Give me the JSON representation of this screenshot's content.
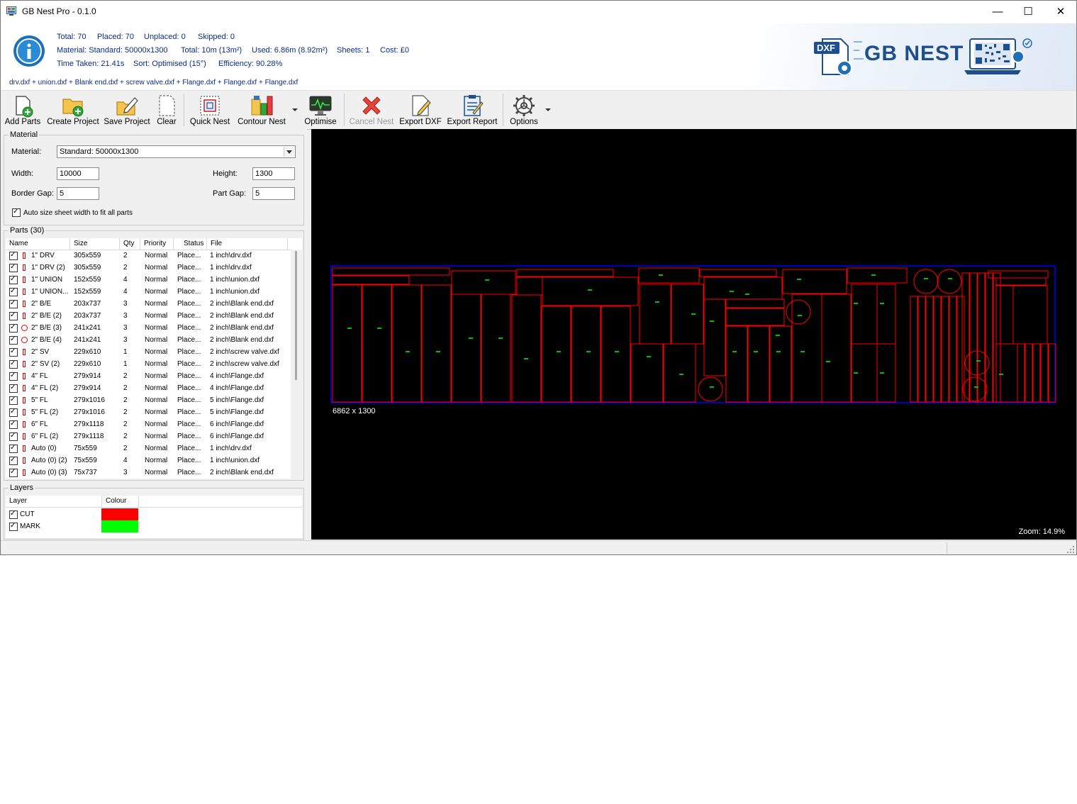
{
  "window": {
    "title": "GB Nest Pro - 0.1.0",
    "controls": {
      "minimize": "—",
      "maximize": "☐",
      "close": "✕"
    }
  },
  "stats": {
    "total": "Total: 70",
    "placed": "Placed: 70",
    "unplaced": "Unplaced: 0",
    "skipped": "Skipped: 0",
    "material": "Material: Standard: 50000x1300",
    "total_len": "Total: 10m (13m²)",
    "used": "Used: 6.86m (8.92m²)",
    "sheets": "Sheets: 1",
    "cost": "Cost: £0",
    "time": "Time Taken: 21.41s",
    "sort": "Sort: Optimised (15°)",
    "efficiency": "Efficiency: 90.28%",
    "files": "drv.dxf + union.dxf + Blank end.dxf + screw valve.dxf + Flange.dxf + Flange.dxf + Flange.dxf"
  },
  "logo": {
    "badge": "DXF",
    "name": "GB NEST"
  },
  "toolbar": {
    "add_parts": "Add Parts",
    "create_project": "Create Project",
    "save_project": "Save Project",
    "clear": "Clear",
    "quick_nest": "Quick Nest",
    "contour_nest": "Contour Nest",
    "optimise": "Optimise",
    "cancel_nest": "Cancel Nest",
    "export_dxf": "Export DXF",
    "export_report": "Export Report",
    "options": "Options"
  },
  "material": {
    "group_title": "Material",
    "material_label": "Material:",
    "material_value": "Standard: 50000x1300",
    "width_label": "Width:",
    "width_value": "10000",
    "height_label": "Height:",
    "height_value": "1300",
    "border_gap_label": "Border Gap:",
    "border_gap_value": "5",
    "part_gap_label": "Part Gap:",
    "part_gap_value": "5",
    "auto_size_label": "Auto size sheet width to fit all parts"
  },
  "parts": {
    "group_title": "Parts (30)",
    "columns": [
      "Name",
      "Size",
      "Qty",
      "Priority",
      "Status",
      "File"
    ],
    "rows": [
      {
        "shape": "rect",
        "name": "1\" DRV",
        "size": "305x559",
        "qty": "2",
        "priority": "Normal",
        "status": "Place...",
        "file": "1 inch\\drv.dxf"
      },
      {
        "shape": "rect",
        "name": "1\" DRV (2)",
        "size": "305x559",
        "qty": "2",
        "priority": "Normal",
        "status": "Place...",
        "file": "1 inch\\drv.dxf"
      },
      {
        "shape": "rect",
        "name": "1\" UNION",
        "size": "152x559",
        "qty": "4",
        "priority": "Normal",
        "status": "Place...",
        "file": "1 inch\\union.dxf"
      },
      {
        "shape": "rect",
        "name": "1\" UNION...",
        "size": "152x559",
        "qty": "4",
        "priority": "Normal",
        "status": "Place...",
        "file": "1 inch\\union.dxf"
      },
      {
        "shape": "rect",
        "name": "2\" B/E",
        "size": "203x737",
        "qty": "3",
        "priority": "Normal",
        "status": "Place...",
        "file": "2 inch\\Blank end.dxf"
      },
      {
        "shape": "rect",
        "name": "2\" B/E (2)",
        "size": "203x737",
        "qty": "3",
        "priority": "Normal",
        "status": "Place...",
        "file": "2 inch\\Blank end.dxf"
      },
      {
        "shape": "circle",
        "name": "2\" B/E (3)",
        "size": "241x241",
        "qty": "3",
        "priority": "Normal",
        "status": "Place...",
        "file": "2 inch\\Blank end.dxf"
      },
      {
        "shape": "circle",
        "name": "2\" B/E (4)",
        "size": "241x241",
        "qty": "3",
        "priority": "Normal",
        "status": "Place...",
        "file": "2 inch\\Blank end.dxf"
      },
      {
        "shape": "rect",
        "name": "2\" SV",
        "size": "229x610",
        "qty": "1",
        "priority": "Normal",
        "status": "Place...",
        "file": "2 inch\\screw valve.dxf"
      },
      {
        "shape": "rect",
        "name": "2\" SV (2)",
        "size": "229x610",
        "qty": "1",
        "priority": "Normal",
        "status": "Place...",
        "file": "2 inch\\screw valve.dxf"
      },
      {
        "shape": "rect",
        "name": "4\" FL",
        "size": "279x914",
        "qty": "2",
        "priority": "Normal",
        "status": "Place...",
        "file": "4 inch\\Flange.dxf"
      },
      {
        "shape": "rect",
        "name": "4\" FL (2)",
        "size": "279x914",
        "qty": "2",
        "priority": "Normal",
        "status": "Place...",
        "file": "4 inch\\Flange.dxf"
      },
      {
        "shape": "rect",
        "name": "5\" FL",
        "size": "279x1016",
        "qty": "2",
        "priority": "Normal",
        "status": "Place...",
        "file": "5 inch\\Flange.dxf"
      },
      {
        "shape": "rect",
        "name": "5\" FL (2)",
        "size": "279x1016",
        "qty": "2",
        "priority": "Normal",
        "status": "Place...",
        "file": "5 inch\\Flange.dxf"
      },
      {
        "shape": "rect",
        "name": "6\" FL",
        "size": "279x1118",
        "qty": "2",
        "priority": "Normal",
        "status": "Place...",
        "file": "6 inch\\Flange.dxf"
      },
      {
        "shape": "rect",
        "name": "6\" FL (2)",
        "size": "279x1118",
        "qty": "2",
        "priority": "Normal",
        "status": "Place...",
        "file": "6 inch\\Flange.dxf"
      },
      {
        "shape": "rect",
        "name": "Auto (0)",
        "size": "75x559",
        "qty": "2",
        "priority": "Normal",
        "status": "Place...",
        "file": "1 inch\\drv.dxf"
      },
      {
        "shape": "rect",
        "name": "Auto (0) (2)",
        "size": "75x559",
        "qty": "4",
        "priority": "Normal",
        "status": "Place...",
        "file": "1 inch\\union.dxf"
      },
      {
        "shape": "rect",
        "name": "Auto (0) (3)",
        "size": "75x737",
        "qty": "3",
        "priority": "Normal",
        "status": "Place...",
        "file": "2 inch\\Blank end.dxf"
      }
    ]
  },
  "layers": {
    "group_title": "Layers",
    "columns": [
      "Layer",
      "Colour"
    ],
    "rows": [
      {
        "name": "CUT",
        "colour": "#ff0000"
      },
      {
        "name": "MARK",
        "colour": "#00ff00"
      }
    ]
  },
  "canvas": {
    "sheet_label": "6862 x 1300",
    "zoom_label": "Zoom: 14.9%",
    "cut_colour": "#ff0000",
    "mark_colour": "#00c000",
    "sheet_colour": "#0000ff"
  }
}
